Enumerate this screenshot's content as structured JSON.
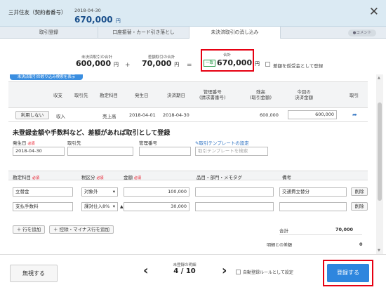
{
  "header": {
    "account": "三井住友（契約者番号）",
    "date": "2018-04-30",
    "amount": "670,000",
    "amount_unit": "円"
  },
  "tabs": [
    "取引登録",
    "口座振替・カード引き落とし",
    "未決済取引の消し込み"
  ],
  "comment_label": "コメント",
  "summary": {
    "unsettled_label": "未決済取引の合計",
    "unsettled_value": "600,000",
    "unit": "円",
    "other_label": "差額取引の合計",
    "other_value": "70,000",
    "total_label": "合計",
    "total_badge": "一致",
    "total_value": "670,000",
    "checkbox_label": "差額を仮受金として登録"
  },
  "blue_pill": "未決済取引の絞り込み検索を表示",
  "table": {
    "headers": {
      "in_out": "収支",
      "partner": "取引先",
      "account": "勘定科目",
      "issue": "発生日",
      "settle": "決済期日",
      "mgmt": "管理番号\n(請求書番号)",
      "due": "残高\n(取引金額)",
      "current": "今回の\n決済金額",
      "txn": "取引"
    },
    "row": {
      "btn": "利用しない",
      "in_out": "収入",
      "partner": "",
      "account": "売上高",
      "issue": "2018-04-01",
      "settle": "2018-04-30",
      "mgmt": "",
      "due": "600,000",
      "current": "600,000"
    }
  },
  "section_title": "未登録金額や手数料など、差額があれば取引として登録",
  "form": {
    "issue_label": "発生日",
    "req": "必須",
    "issue_value": "2018-04-30",
    "partner_label": "取引先",
    "mgmt_label": "管理番号",
    "template_link": "取引テンプレートの設定",
    "template_placeholder": "取引テンプレートを検索"
  },
  "lines": {
    "headers": {
      "account": "勘定科目",
      "tax": "税区分",
      "amount": "金額",
      "items": "品目・部門・メモタグ",
      "note": "備考"
    },
    "rows": [
      {
        "account": "立替金",
        "tax": "対象外",
        "amount": "100,000",
        "note": "交通費立替分",
        "delete": "削除"
      },
      {
        "account": "支払手数料",
        "tax": "課対仕入8%",
        "amount": "30,000",
        "note": "",
        "delete": "削除"
      }
    ],
    "add_row": "＋ 行を追加",
    "add_minus": "＋ 控除・マイナス行を追加",
    "total_label": "合計",
    "total_value": "70,000",
    "diff_label": "明細との差額",
    "diff_value": "0"
  },
  "footer": {
    "cancel": "無視する",
    "pager_caption": "未登録の明細",
    "pager_value": "4 / 10",
    "auto_rule": "自動登録ルールとして設定",
    "register": "登録する"
  }
}
